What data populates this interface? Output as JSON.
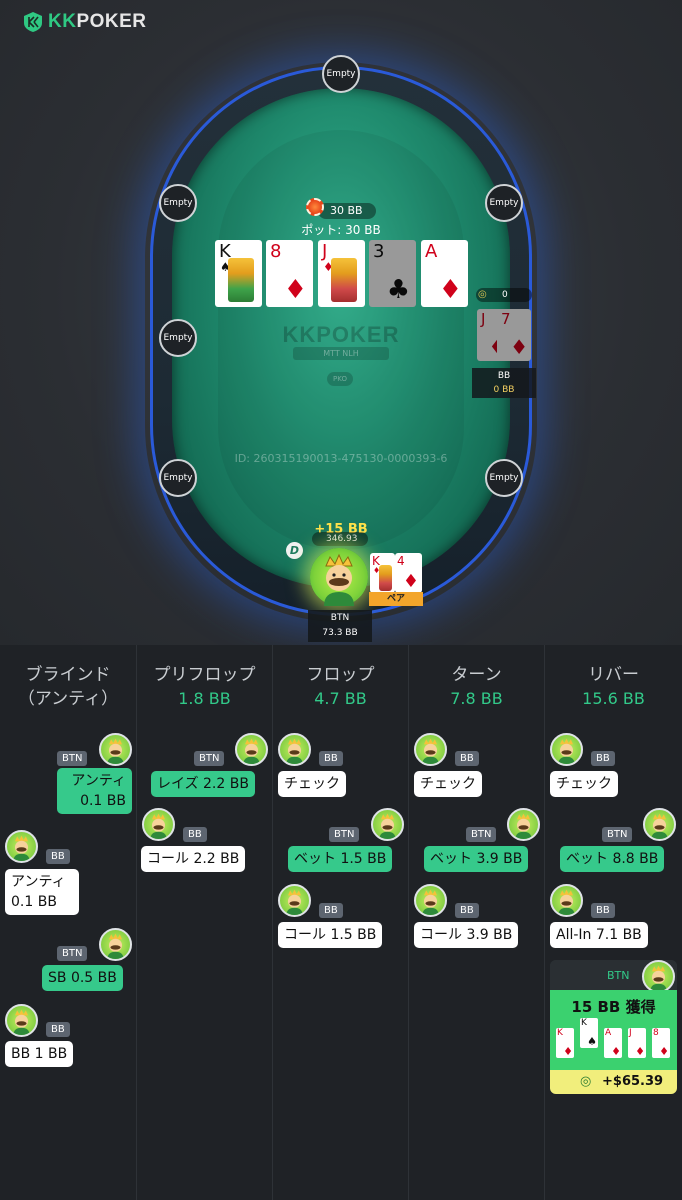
{
  "brand": {
    "logo_kk": "KK",
    "logo_poker": "POKER"
  },
  "table": {
    "empty_seats": [
      "Empty",
      "Empty",
      "Empty",
      "Empty",
      "Empty",
      "Empty",
      "Empty"
    ],
    "pot_bet": "30 BB",
    "pot_total": "ポット: 30 BB",
    "felt_logo": "KKPOKER",
    "felt_sub": "MTT NLH",
    "felt_chip": "PKO",
    "hand_id": "ID: 260315190013-475130-0000393-6",
    "board": [
      {
        "rank": "K",
        "suit": "♠",
        "color": "black",
        "face": true
      },
      {
        "rank": "8",
        "suit": "♦",
        "color": "red",
        "face": false
      },
      {
        "rank": "J",
        "suit": "♦",
        "color": "red",
        "face": true
      },
      {
        "rank": "3",
        "suit": "♣",
        "color": "black",
        "face": false,
        "dim": true
      },
      {
        "rank": "A",
        "suit": "♦",
        "color": "red",
        "face": false
      }
    ],
    "opponent": {
      "bet": "0",
      "position": "BB",
      "stack": "0 BB",
      "cards": [
        {
          "rank": "J",
          "suit": "♦"
        },
        {
          "rank": "7",
          "suit": "♦"
        }
      ]
    },
    "hero": {
      "win": "+15 BB",
      "balance": "346.93",
      "dealer": "D",
      "position": "BTN",
      "stack": "73.3 BB",
      "cards": [
        {
          "rank": "K",
          "suit": "♦"
        },
        {
          "rank": "4",
          "suit": "♦"
        }
      ],
      "hand_tag": "ペア"
    }
  },
  "history": {
    "columns": [
      {
        "title": "ブラインド",
        "title2": "（アンティ）",
        "amount": ""
      },
      {
        "title": "プリフロップ",
        "amount": "1.8 BB"
      },
      {
        "title": "フロップ",
        "amount": "4.7 BB"
      },
      {
        "title": "ターン",
        "amount": "7.8 BB"
      },
      {
        "title": "リバー",
        "amount": "15.6 BB"
      }
    ],
    "blinds": [
      {
        "pos": "BTN",
        "text": "アンティ",
        "text2": "0.1 BB"
      },
      {
        "pos": "BB",
        "text": "アンティ",
        "text2": "0.1 BB"
      },
      {
        "pos": "BTN",
        "text": "SB 0.5 BB"
      },
      {
        "pos": "BB",
        "text": "BB 1 BB"
      }
    ],
    "preflop": [
      {
        "pos": "BTN",
        "text": "レイズ 2.2 BB"
      },
      {
        "pos": "BB",
        "text": "コール 2.2 BB"
      }
    ],
    "flop": [
      {
        "pos": "BB",
        "text": "チェック"
      },
      {
        "pos": "BTN",
        "text": "ベット 1.5 BB"
      },
      {
        "pos": "BB",
        "text": "コール 1.5 BB"
      }
    ],
    "turn": [
      {
        "pos": "BB",
        "text": "チェック"
      },
      {
        "pos": "BTN",
        "text": "ベット 3.9 BB"
      },
      {
        "pos": "BB",
        "text": "コール 3.9 BB"
      }
    ],
    "river": [
      {
        "pos": "BB",
        "text": "チェック"
      },
      {
        "pos": "BTN",
        "text": "ベット 8.8 BB"
      },
      {
        "pos": "BB",
        "text": "All-In 7.1 BB"
      }
    ],
    "result": {
      "pos": "BTN",
      "title": "15 BB 獲得",
      "amount": "+$65.39",
      "cards": [
        {
          "rank": "K",
          "suit": "♦",
          "color": "red"
        },
        {
          "rank": "K",
          "suit": "♠",
          "color": "black"
        },
        {
          "rank": "A",
          "suit": "♦",
          "color": "red"
        },
        {
          "rank": "J",
          "suit": "♦",
          "color": "red"
        },
        {
          "rank": "8",
          "suit": "♦",
          "color": "red"
        }
      ]
    }
  },
  "colors": {
    "accent_green": "#32c989",
    "bubble_green": "#36c98b",
    "win_yellow": "#ffe14b",
    "felt": "#1f8a6d"
  }
}
